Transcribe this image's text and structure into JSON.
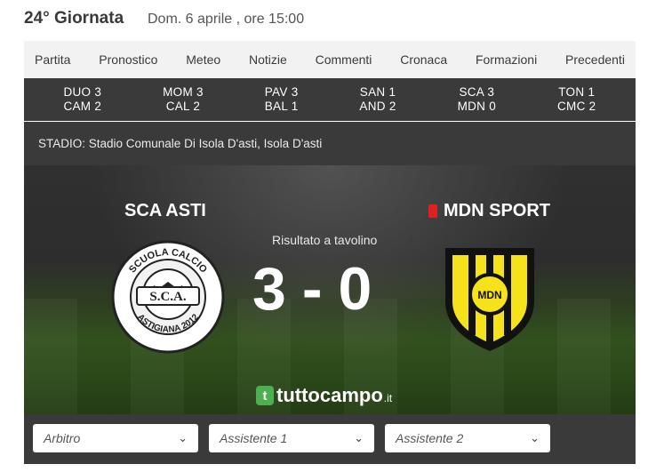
{
  "header": {
    "round": "24° Giornata",
    "datetime": "Dom. 6 aprile , ore 15:00"
  },
  "tabs": [
    "Partita",
    "Pronostico",
    "Meteo",
    "Notizie",
    "Commenti",
    "Cronaca",
    "Formazioni",
    "Precedenti"
  ],
  "other_results": [
    {
      "line1": "DUO 3",
      "line2": "CAM 2"
    },
    {
      "line1": "MOM 3",
      "line2": "CAL 2"
    },
    {
      "line1": "PAV 3",
      "line2": "BAL 1"
    },
    {
      "line1": "SAN 1",
      "line2": "AND 2"
    },
    {
      "line1": "SCA 3",
      "line2": "MDN 0"
    },
    {
      "line1": "TON 1",
      "line2": "CMC 2"
    }
  ],
  "stadium": "STADIO: Stadio Comunale Di Isola D'asti, Isola D'asti",
  "match": {
    "home": "SCA ASTI",
    "away": "MDN SPORT",
    "result_note": "Risultato a tavolino",
    "home_score": "3",
    "away_score": "0",
    "separator": "-"
  },
  "logos": {
    "home_text_top": "SCUOLA CALCIO",
    "home_text_mid": "S.C.A.",
    "home_text_bottom": "ASTIGIANA 2012",
    "away_text": "MDN"
  },
  "brand": {
    "badge": "t",
    "name": "tuttocampo",
    "suffix": ".it"
  },
  "filters": {
    "arbitro": "Arbitro",
    "assistente1": "Assistente 1",
    "assistente2": "Assistente 2"
  },
  "colors": {
    "away_yellow": "#f5e21b",
    "card_red": "#e02020",
    "brand_green": "#4caf50"
  }
}
